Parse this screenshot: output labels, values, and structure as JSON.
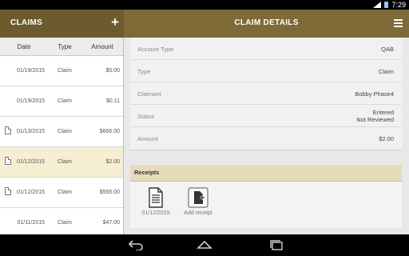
{
  "statusbar": {
    "time": "7:29",
    "signal": "3G"
  },
  "appbar": {
    "left_title": "CLAIMS",
    "add_icon": "plus-icon",
    "title": "CLAIM DETAILS",
    "menu_icon": "hamburger-menu-icon"
  },
  "claims_table": {
    "headers": [
      "Date",
      "Type",
      "Amount"
    ],
    "rows": [
      {
        "date": "01/19/2015",
        "type": "Claim",
        "amount": "$5.00",
        "has_receipt": false
      },
      {
        "date": "01/19/2015",
        "type": "Claim",
        "amount": "$0.11",
        "has_receipt": false
      },
      {
        "date": "01/13/2015",
        "type": "Claim",
        "amount": "$666.00",
        "has_receipt": true
      },
      {
        "date": "01/12/2015",
        "type": "Claim",
        "amount": "$2.00",
        "has_receipt": true,
        "selected": true
      },
      {
        "date": "01/12/2015",
        "type": "Claim",
        "amount": "$555.00",
        "has_receipt": true
      },
      {
        "date": "01/11/2015",
        "type": "Claim",
        "amount": "$47.00",
        "has_receipt": false
      }
    ]
  },
  "details": {
    "account_type": {
      "label": "Account Type",
      "value": "QAB"
    },
    "type": {
      "label": "Type",
      "value": "Claim"
    },
    "claimant": {
      "label": "Claimant",
      "value": "Bobby Phase4"
    },
    "status": {
      "label": "Status",
      "value_line1": "Entered",
      "value_line2": "Not Reviewed"
    },
    "amount": {
      "label": "Amount",
      "value": "$2.00"
    }
  },
  "receipts": {
    "header": "Receipts",
    "items": [
      {
        "label": "01/12/2015",
        "icon": "document-icon"
      },
      {
        "label": "Add receipt",
        "icon": "add-document-icon"
      }
    ]
  },
  "navbar": {
    "back_icon": "back-icon",
    "home_icon": "home-icon",
    "recent_icon": "recent-apps-icon"
  },
  "colors": {
    "appbar": "#7d6a36",
    "appbar_left": "#6c5b2d",
    "selected_row": "#f6eed3",
    "receipts_header": "#e7dbbc"
  }
}
